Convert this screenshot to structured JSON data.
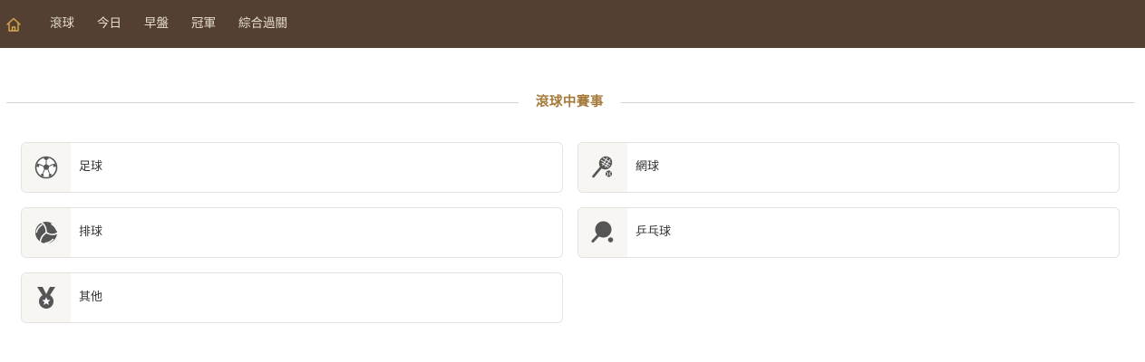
{
  "nav": {
    "home_icon": "home-icon",
    "items": [
      "滾球",
      "今日",
      "早盤",
      "冠軍",
      "綜合過關"
    ]
  },
  "section": {
    "title": "滾球中賽事"
  },
  "sports": [
    {
      "label": "足球",
      "icon": "soccer-ball-icon"
    },
    {
      "label": "網球",
      "icon": "tennis-racket-icon"
    },
    {
      "label": "排球",
      "icon": "volleyball-icon"
    },
    {
      "label": "乒乓球",
      "icon": "table-tennis-icon"
    },
    {
      "label": "其他",
      "icon": "medal-icon"
    }
  ],
  "colors": {
    "nav_bg": "#544033",
    "nav_text": "#e4dccf",
    "home_icon": "#d9a84e",
    "accent": "#a5793a",
    "icon": "#555555"
  }
}
